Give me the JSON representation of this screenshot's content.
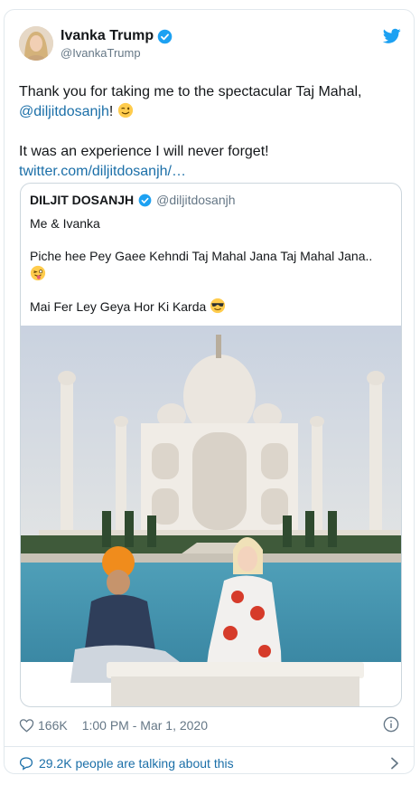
{
  "author": {
    "display_name": "Ivanka Trump",
    "handle": "@IvankaTrump"
  },
  "tweet": {
    "line1_text": "Thank you for taking me to the spectacular Taj Mahal,",
    "mention": "@diljitdosanjh",
    "after_mention": "!",
    "line2_text": "It was an experience I will never forget!",
    "link": "twitter.com/diljitdosanjh/…"
  },
  "quoted": {
    "display_name": "DILJIT DOSANJH",
    "handle": "@diljitdosanjh",
    "line1": "Me & Ivanka",
    "line2": "Piche hee Pey Gaee Kehndi Taj Mahal Jana Taj Mahal Jana..",
    "line3": "Mai Fer Ley Geya Hor Ki Karda"
  },
  "footer": {
    "likes": "166K",
    "timestamp": "1:00 PM - Mar 1, 2020"
  },
  "talking": {
    "label": "29.2K people are talking about this"
  },
  "colors": {
    "link": "#1b6fa8",
    "verified": "#1da1f2",
    "border": "#e1e8ed"
  },
  "icons": [
    "verified-badge-icon",
    "twitter-bird-icon",
    "heart-icon",
    "info-icon",
    "comment-icon",
    "chevron-right-icon",
    "wink-emoji",
    "tongue-emoji",
    "sunglasses-emoji"
  ]
}
